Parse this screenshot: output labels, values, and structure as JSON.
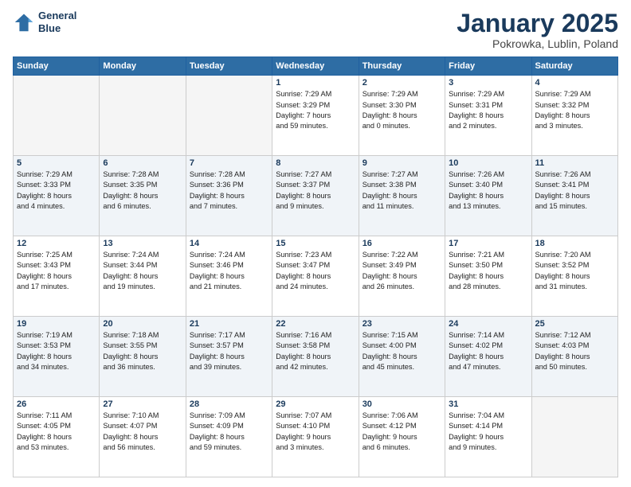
{
  "header": {
    "logo_line1": "General",
    "logo_line2": "Blue",
    "month": "January 2025",
    "location": "Pokrowka, Lublin, Poland"
  },
  "days_of_week": [
    "Sunday",
    "Monday",
    "Tuesday",
    "Wednesday",
    "Thursday",
    "Friday",
    "Saturday"
  ],
  "weeks": [
    [
      {
        "day": "",
        "info": ""
      },
      {
        "day": "",
        "info": ""
      },
      {
        "day": "",
        "info": ""
      },
      {
        "day": "1",
        "info": "Sunrise: 7:29 AM\nSunset: 3:29 PM\nDaylight: 7 hours\nand 59 minutes."
      },
      {
        "day": "2",
        "info": "Sunrise: 7:29 AM\nSunset: 3:30 PM\nDaylight: 8 hours\nand 0 minutes."
      },
      {
        "day": "3",
        "info": "Sunrise: 7:29 AM\nSunset: 3:31 PM\nDaylight: 8 hours\nand 2 minutes."
      },
      {
        "day": "4",
        "info": "Sunrise: 7:29 AM\nSunset: 3:32 PM\nDaylight: 8 hours\nand 3 minutes."
      }
    ],
    [
      {
        "day": "5",
        "info": "Sunrise: 7:29 AM\nSunset: 3:33 PM\nDaylight: 8 hours\nand 4 minutes."
      },
      {
        "day": "6",
        "info": "Sunrise: 7:28 AM\nSunset: 3:35 PM\nDaylight: 8 hours\nand 6 minutes."
      },
      {
        "day": "7",
        "info": "Sunrise: 7:28 AM\nSunset: 3:36 PM\nDaylight: 8 hours\nand 7 minutes."
      },
      {
        "day": "8",
        "info": "Sunrise: 7:27 AM\nSunset: 3:37 PM\nDaylight: 8 hours\nand 9 minutes."
      },
      {
        "day": "9",
        "info": "Sunrise: 7:27 AM\nSunset: 3:38 PM\nDaylight: 8 hours\nand 11 minutes."
      },
      {
        "day": "10",
        "info": "Sunrise: 7:26 AM\nSunset: 3:40 PM\nDaylight: 8 hours\nand 13 minutes."
      },
      {
        "day": "11",
        "info": "Sunrise: 7:26 AM\nSunset: 3:41 PM\nDaylight: 8 hours\nand 15 minutes."
      }
    ],
    [
      {
        "day": "12",
        "info": "Sunrise: 7:25 AM\nSunset: 3:43 PM\nDaylight: 8 hours\nand 17 minutes."
      },
      {
        "day": "13",
        "info": "Sunrise: 7:24 AM\nSunset: 3:44 PM\nDaylight: 8 hours\nand 19 minutes."
      },
      {
        "day": "14",
        "info": "Sunrise: 7:24 AM\nSunset: 3:46 PM\nDaylight: 8 hours\nand 21 minutes."
      },
      {
        "day": "15",
        "info": "Sunrise: 7:23 AM\nSunset: 3:47 PM\nDaylight: 8 hours\nand 24 minutes."
      },
      {
        "day": "16",
        "info": "Sunrise: 7:22 AM\nSunset: 3:49 PM\nDaylight: 8 hours\nand 26 minutes."
      },
      {
        "day": "17",
        "info": "Sunrise: 7:21 AM\nSunset: 3:50 PM\nDaylight: 8 hours\nand 28 minutes."
      },
      {
        "day": "18",
        "info": "Sunrise: 7:20 AM\nSunset: 3:52 PM\nDaylight: 8 hours\nand 31 minutes."
      }
    ],
    [
      {
        "day": "19",
        "info": "Sunrise: 7:19 AM\nSunset: 3:53 PM\nDaylight: 8 hours\nand 34 minutes."
      },
      {
        "day": "20",
        "info": "Sunrise: 7:18 AM\nSunset: 3:55 PM\nDaylight: 8 hours\nand 36 minutes."
      },
      {
        "day": "21",
        "info": "Sunrise: 7:17 AM\nSunset: 3:57 PM\nDaylight: 8 hours\nand 39 minutes."
      },
      {
        "day": "22",
        "info": "Sunrise: 7:16 AM\nSunset: 3:58 PM\nDaylight: 8 hours\nand 42 minutes."
      },
      {
        "day": "23",
        "info": "Sunrise: 7:15 AM\nSunset: 4:00 PM\nDaylight: 8 hours\nand 45 minutes."
      },
      {
        "day": "24",
        "info": "Sunrise: 7:14 AM\nSunset: 4:02 PM\nDaylight: 8 hours\nand 47 minutes."
      },
      {
        "day": "25",
        "info": "Sunrise: 7:12 AM\nSunset: 4:03 PM\nDaylight: 8 hours\nand 50 minutes."
      }
    ],
    [
      {
        "day": "26",
        "info": "Sunrise: 7:11 AM\nSunset: 4:05 PM\nDaylight: 8 hours\nand 53 minutes."
      },
      {
        "day": "27",
        "info": "Sunrise: 7:10 AM\nSunset: 4:07 PM\nDaylight: 8 hours\nand 56 minutes."
      },
      {
        "day": "28",
        "info": "Sunrise: 7:09 AM\nSunset: 4:09 PM\nDaylight: 8 hours\nand 59 minutes."
      },
      {
        "day": "29",
        "info": "Sunrise: 7:07 AM\nSunset: 4:10 PM\nDaylight: 9 hours\nand 3 minutes."
      },
      {
        "day": "30",
        "info": "Sunrise: 7:06 AM\nSunset: 4:12 PM\nDaylight: 9 hours\nand 6 minutes."
      },
      {
        "day": "31",
        "info": "Sunrise: 7:04 AM\nSunset: 4:14 PM\nDaylight: 9 hours\nand 9 minutes."
      },
      {
        "day": "",
        "info": ""
      }
    ]
  ]
}
